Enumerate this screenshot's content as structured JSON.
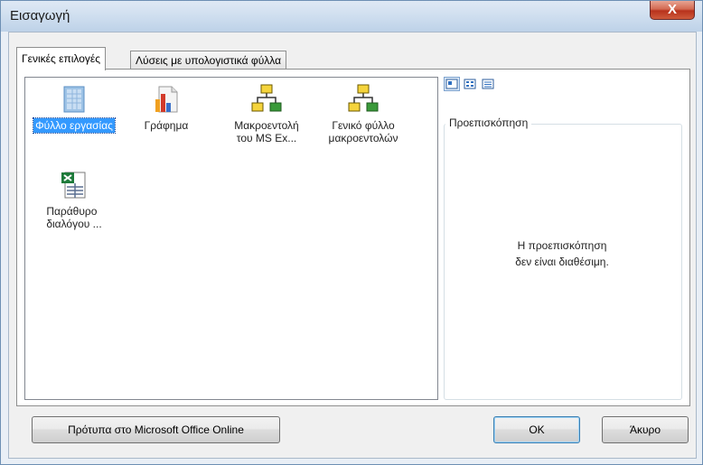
{
  "window": {
    "title": "Εισαγωγή",
    "close_glyph": "X"
  },
  "tabs": [
    {
      "label": "Γενικές επιλογές",
      "active": true
    },
    {
      "label": "Λύσεις με υπολογιστικά φύλλα",
      "active": false
    }
  ],
  "templates": [
    {
      "label": "Φύλλο εργασίας",
      "icon": "worksheet-icon",
      "selected": true
    },
    {
      "label": "Γράφημα",
      "icon": "chart-icon",
      "selected": false
    },
    {
      "label_line1": "Μακροεντολή",
      "label_line2": "του MS Ex...",
      "icon": "macro-icon",
      "selected": false
    },
    {
      "label_line1": "Γενικό φύλλο",
      "label_line2": "μακροεντολών",
      "icon": "macro-icon",
      "selected": false
    },
    {
      "label_line1": "Παράθυρο",
      "label_line2": "διαλόγου ...",
      "icon": "dialog-sheet-icon",
      "selected": false
    }
  ],
  "view_buttons": [
    "large-icons-icon",
    "list-view-icon",
    "details-view-icon"
  ],
  "preview": {
    "legend": "Προεπισκόπηση",
    "message_line1": "Η προεπισκόπηση",
    "message_line2": "δεν είναι διαθέσιμη."
  },
  "buttons": {
    "templates_online": "Πρότυπα στο Microsoft Office Online",
    "ok": "OK",
    "cancel": "Άκυρο"
  },
  "colors": {
    "selection": "#3399ff",
    "title_gradient_top": "#dfe9f5",
    "close_red": "#c7402a"
  }
}
